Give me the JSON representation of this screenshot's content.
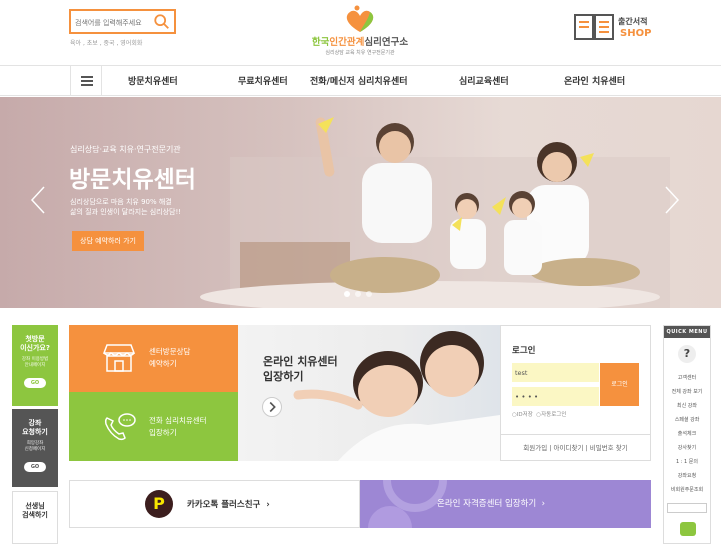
{
  "header": {
    "search_placeholder": "검색어를 입력해주세요",
    "tags": "육아 , 초보 , 중국 , 영어회화",
    "logo_title_part1": "한국",
    "logo_title_part2": "인간관계",
    "logo_title_part3": "심리연구소",
    "logo_subtitle": "심리상담 교육 치유 연구전문기관",
    "publication_label": "출간서적",
    "shop_label": "SHOP"
  },
  "nav": {
    "items": [
      "방문치유센터",
      "무료치유센터",
      "전화/메신저 심리치유센터",
      "심리교육센터",
      "온라인 치유센터"
    ]
  },
  "hero": {
    "subtitle": "심리상담·교육 치유·연구전문기관",
    "title": "방문치유센터",
    "desc_line1": "심리상담으로 마음 치유 90% 해결",
    "desc_line2": "삶의 질과 인생이 달라지는 심리상담!!",
    "cta": "상담 예약하러 가기",
    "slide_count": 3,
    "active_slide": 1
  },
  "left_sidebar": {
    "first_visit_title": "첫방문\n이신가요?",
    "first_visit_sub": "강좌 이용방법\n안내페이지",
    "go1": "GO",
    "lecture_title": "강좌\n요청하기",
    "lecture_sub": "희망강좌\n신청페이지",
    "go2": "GO",
    "teacher_title": "선생님\n검색하기"
  },
  "cards": {
    "visit_line1": "센터방문상담",
    "visit_line2": "예약하기",
    "phone_line1": "전화 심리치유센터",
    "phone_line2": "입장하기"
  },
  "online_banner": {
    "line1": "온라인 치유센터",
    "line2": "입장하기"
  },
  "login": {
    "title": "로그인",
    "id_value": "test",
    "pw_value": "• • • •",
    "button": "로그인",
    "save_id": "ID저장",
    "auto_login": "자동로그인",
    "links": "회원가입 | 아이디찾기 | 비밀번호 찾기"
  },
  "bottom": {
    "kakao_icon": "P",
    "kakao": "카카오톡 플러스친구",
    "cert": "온라인 자격증센터 입장하기"
  },
  "quick_menu": {
    "header": "QUICK MENU",
    "icon": "?",
    "items": [
      "고객센터",
      "전체 강좌 보기",
      "최신 강좌",
      "스페셜 강좌",
      "출석체크",
      "강사찾기",
      "1 : 1 문의",
      "강좌요청",
      "비회원주문조회"
    ]
  },
  "colors": {
    "orange": "#f5913e",
    "green": "#8dc63f",
    "purple": "#9d87d4",
    "dark": "#555555"
  }
}
